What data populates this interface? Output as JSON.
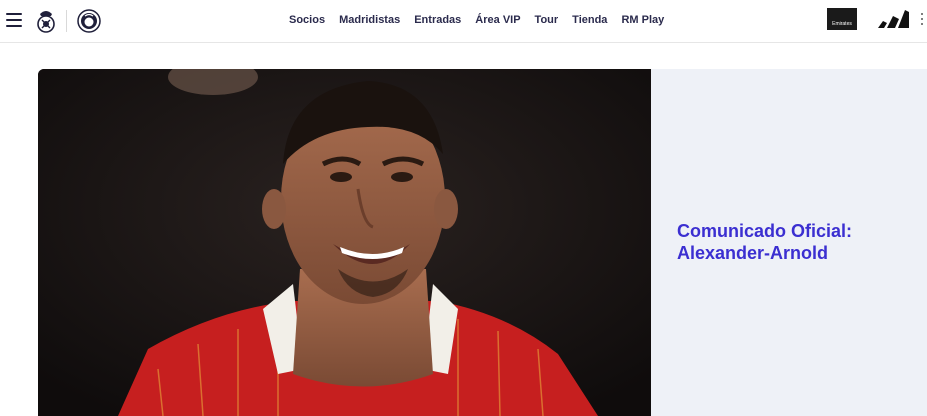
{
  "header": {
    "nav": [
      "Socios",
      "Madridistas",
      "Entradas",
      "Área VIP",
      "Tour",
      "Tienda",
      "RM Play"
    ],
    "sponsor_emirates": "Emirates"
  },
  "hero": {
    "headline_line1": "Comunicado Oficial:",
    "headline_line2": "Alexander-Arnold"
  },
  "icons": {
    "menu": "hamburger-menu-icon",
    "crest": "real-madrid-crest-icon",
    "badge": "anniversary-badge-icon",
    "adidas": "adidas-logo-icon",
    "more": "more-vertical-icon"
  },
  "colors": {
    "headline": "#3b2fd1",
    "panel": "#eef1f7",
    "nav_text": "#2b2b4d"
  }
}
